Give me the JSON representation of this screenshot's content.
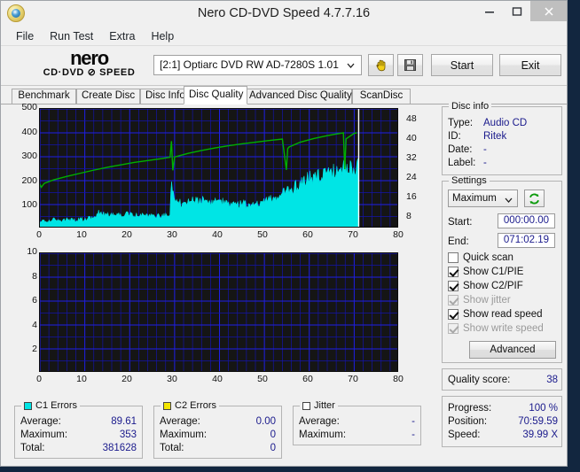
{
  "window": {
    "title": "Nero CD-DVD Speed 4.7.7.16",
    "app_icon": "nero-app-icon",
    "controls": {
      "minimize": "minimize-icon",
      "maximize": "maximize-icon",
      "close": "close-icon"
    }
  },
  "menubar": {
    "items": [
      "File",
      "Run Test",
      "Extra",
      "Help"
    ]
  },
  "toolbar": {
    "logo_word": "nero",
    "logo_sub": "CD·DVD ⊘ SPEED",
    "drive": "[2:1]   Optiarc DVD RW AD-7280S 1.01",
    "hand_button": "hand-icon",
    "save_button": "floppy-save-icon",
    "start_label": "Start",
    "exit_label": "Exit"
  },
  "tabs": {
    "items": [
      "Benchmark",
      "Create Disc",
      "Disc Info",
      "Disc Quality",
      "Advanced Disc Quality",
      "ScanDisc"
    ],
    "active": "Disc Quality"
  },
  "disc_info": {
    "title": "Disc info",
    "rows": [
      {
        "key": "Type:",
        "value": "Audio CD"
      },
      {
        "key": "ID:",
        "value": "Ritek"
      },
      {
        "key": "Date:",
        "value": "-"
      },
      {
        "key": "Label:",
        "value": "-"
      }
    ]
  },
  "settings": {
    "title": "Settings",
    "speed_selected": "Maximum",
    "speed_options": [
      "Maximum"
    ],
    "refresh_icon": "refresh-icon",
    "start_label": "Start:",
    "start_value": "000:00.00",
    "end_label": "End:",
    "end_value": "071:02.19",
    "checkboxes": [
      {
        "label": "Quick scan",
        "checked": false,
        "enabled": true
      },
      {
        "label": "Show C1/PIE",
        "checked": true,
        "enabled": true
      },
      {
        "label": "Show C2/PIF",
        "checked": true,
        "enabled": true
      },
      {
        "label": "Show jitter",
        "checked": true,
        "enabled": false
      },
      {
        "label": "Show read speed",
        "checked": true,
        "enabled": true
      },
      {
        "label": "Show write speed",
        "checked": true,
        "enabled": false
      }
    ],
    "advanced_label": "Advanced"
  },
  "quality": {
    "label": "Quality score:",
    "value": "38"
  },
  "progress": {
    "rows": [
      {
        "key": "Progress:",
        "value": "100 %"
      },
      {
        "key": "Position:",
        "value": "70:59.59"
      },
      {
        "key": "Speed:",
        "value": "39.99 X"
      }
    ]
  },
  "stats": {
    "c1": {
      "title": "C1 Errors",
      "color": "#00e5e5",
      "rows": [
        {
          "key": "Average:",
          "value": "89.61"
        },
        {
          "key": "Maximum:",
          "value": "353"
        },
        {
          "key": "Total:",
          "value": "381628"
        }
      ]
    },
    "c2": {
      "title": "C2 Errors",
      "color": "#f2e500",
      "rows": [
        {
          "key": "Average:",
          "value": "0.00"
        },
        {
          "key": "Maximum:",
          "value": "0"
        },
        {
          "key": "Total:",
          "value": "0"
        }
      ]
    },
    "jitter": {
      "title": "Jitter",
      "color": "#ffffff",
      "rows": [
        {
          "key": "Average:",
          "value": "-"
        },
        {
          "key": "Maximum:",
          "value": "-"
        }
      ]
    }
  },
  "chart_data": [
    {
      "id": "c1-chart",
      "type": "area",
      "title": "",
      "xlabel": "",
      "ylabel": "C1 errors",
      "xlim": [
        0,
        80
      ],
      "ylim": [
        0,
        500
      ],
      "y2lim": [
        0,
        50
      ],
      "y2ticks": [
        8,
        16,
        24,
        32,
        40,
        48
      ],
      "xticks": [
        0,
        10,
        20,
        30,
        40,
        50,
        60,
        70,
        80
      ],
      "yticks": [
        100,
        200,
        300,
        400,
        500
      ],
      "grid": true,
      "bg": "#151515",
      "grid_color": "#0000cc",
      "scan_end_x": 71,
      "series": [
        {
          "name": "C1 Errors",
          "color": "#00e5e5",
          "kind": "area",
          "axis": "left",
          "x": [
            0,
            1,
            2,
            3,
            4,
            5,
            6,
            7,
            8,
            9,
            10,
            11,
            12,
            13,
            14,
            15,
            16,
            17,
            18,
            19,
            20,
            21,
            22,
            23,
            24,
            25,
            26,
            27,
            28,
            29,
            29.2,
            30,
            31,
            32,
            33,
            34,
            35,
            36,
            37,
            38,
            39,
            40,
            41,
            42,
            43,
            44,
            45,
            46,
            47,
            48,
            49,
            50,
            51,
            52,
            53,
            54,
            55,
            56,
            57,
            58,
            59,
            60,
            61,
            62,
            63,
            64,
            65,
            66,
            67,
            68,
            69,
            70,
            70.8
          ],
          "values": [
            26,
            33,
            30,
            36,
            34,
            31,
            38,
            35,
            33,
            39,
            36,
            42,
            40,
            65,
            60,
            57,
            62,
            58,
            55,
            60,
            57,
            52,
            56,
            54,
            51,
            55,
            53,
            50,
            54,
            48,
            190,
            100,
            108,
            104,
            112,
            118,
            110,
            116,
            106,
            112,
            108,
            104,
            110,
            100,
            106,
            96,
            102,
            98,
            104,
            94,
            100,
            108,
            116,
            124,
            132,
            140,
            148,
            160,
            172,
            185,
            198,
            212,
            205,
            222,
            215,
            232,
            225,
            240,
            236,
            248,
            244,
            252,
            248,
            240
          ]
        },
        {
          "name": "Read speed",
          "color": "#00b000",
          "kind": "line",
          "axis": "right",
          "x": [
            0,
            0.3,
            1,
            3,
            6,
            9,
            12,
            15,
            18,
            21,
            24,
            27,
            29,
            29.3,
            29.6,
            30,
            33,
            36,
            39,
            42,
            45,
            48,
            51,
            54,
            54.9,
            55.2,
            55.5,
            58,
            61,
            64,
            66,
            67.6,
            67.9,
            68.2,
            70,
            70.6
          ],
          "values": [
            18.5,
            17.2,
            18.9,
            20.3,
            21.8,
            23.1,
            24.4,
            25.6,
            26.6,
            27.6,
            28.4,
            29.2,
            29.8,
            36.5,
            24.3,
            29.9,
            31.4,
            32.6,
            33.7,
            34.6,
            35.4,
            36.1,
            36.8,
            37.4,
            24.5,
            33.4,
            34.1,
            36.1,
            37.6,
            38.8,
            39.5,
            40.0,
            24.8,
            37.5,
            39.8,
            40.0
          ]
        }
      ]
    },
    {
      "id": "jitter-chart",
      "type": "line",
      "title": "",
      "xlabel": "",
      "ylabel": "Jitter",
      "xlim": [
        0,
        80
      ],
      "ylim": [
        0,
        10
      ],
      "xticks": [
        0,
        10,
        20,
        30,
        40,
        50,
        60,
        70,
        80
      ],
      "yticks": [
        2,
        4,
        6,
        8,
        10
      ],
      "grid": true,
      "bg": "#151515",
      "grid_color": "#0000cc",
      "series": []
    }
  ]
}
